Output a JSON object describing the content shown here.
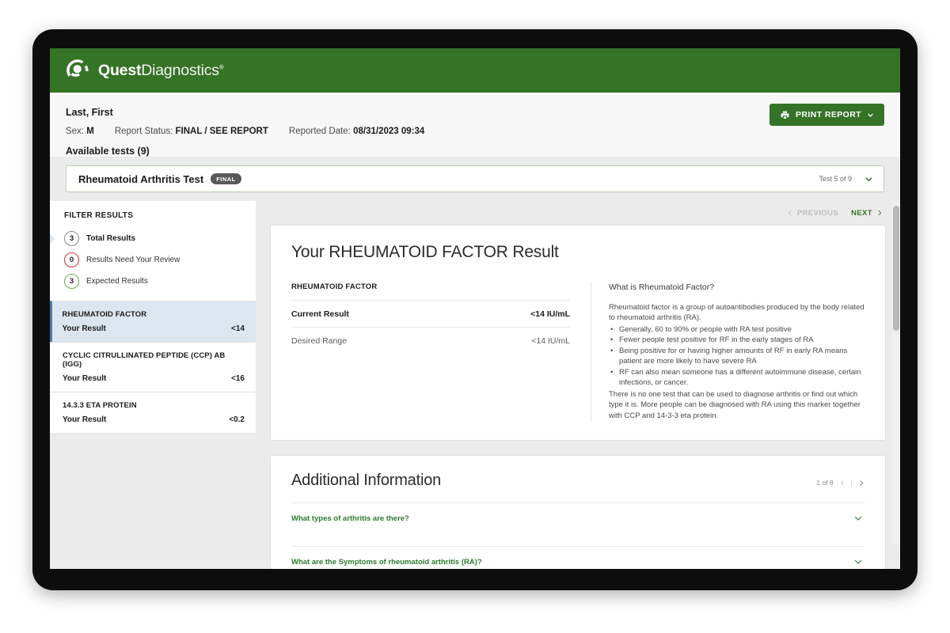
{
  "brand": {
    "name_bold": "Quest",
    "name_light": "Diagnostics",
    "registered_mark": "®",
    "logo_icon": "quest-swirl-logo",
    "header_color": "#357326"
  },
  "patient": {
    "name": "Last, First",
    "sex_label": "Sex:",
    "sex_value": "M",
    "report_status_label": "Report Status:",
    "report_status_value": "FINAL / SEE REPORT",
    "reported_date_label": "Reported Date:",
    "reported_date_value": "08/31/2023 09:34",
    "available_tests": "Available tests (9)"
  },
  "print_button": {
    "label": "PRINT REPORT",
    "icon": "printer-icon",
    "caret_icon": "chevron-down-icon"
  },
  "test_selector": {
    "title": "Rheumatoid Arthritis Test",
    "badge": "FINAL",
    "counter": "Test 5 of 9",
    "caret_icon": "chevron-down-icon"
  },
  "filter": {
    "title": "FILTER RESULTS",
    "items": [
      {
        "count": "3",
        "label": "Total Results",
        "color": "#8a8a8a",
        "active": true
      },
      {
        "count": "0",
        "label": "Results Need Your Review",
        "color": "#d0342c",
        "active": false
      },
      {
        "count": "3",
        "label": "Expected Results",
        "color": "#6aa84f",
        "active": false
      }
    ]
  },
  "test_list": [
    {
      "name": "RHEUMATOID FACTOR",
      "result_label": "Your Result",
      "result_value": "<14",
      "selected": true
    },
    {
      "name": "CYCLIC CITRULLINATED PEPTIDE (CCP) AB (IGG)",
      "result_label": "Your Result",
      "result_value": "<16",
      "selected": false
    },
    {
      "name": "14.3.3 ETA PROTEIN",
      "result_label": "Your Result",
      "result_value": "<0.2",
      "selected": false
    }
  ],
  "pager": {
    "previous": "PREVIOUS",
    "next": "NEXT",
    "prev_icon": "chevron-left-icon",
    "next_icon": "chevron-right-icon"
  },
  "result": {
    "title": "Your RHEUMATOID FACTOR Result",
    "analyte": "RHEUMATOID FACTOR",
    "rows": [
      {
        "label": "Current Result",
        "value": "<14 IU/mL"
      },
      {
        "label": "Desired Range",
        "value": "<14 IU/mL"
      }
    ],
    "info_heading": "What is Rheumatoid Factor?",
    "info_intro": "Rheumatoid factor is a group of autoantibodies produced by the body related to rheumatoid arthritis (RA).",
    "info_bullets": [
      "Generally, 60 to 90% or people with RA test positive",
      "Fewer people test positive for RF in the early stages of RA",
      "Being positive for or having higher amounts of RF in early RA means patient are more likely to have severe RA",
      "RF can also mean someone has a different autoimmune disease, certain infections, or cancer."
    ],
    "info_outro": "There is no one test that can be used to diagnose arthritis or find out which type it is. More people can be diagnosed with RA using this marker together with CCP and 14-3-3 eta protein."
  },
  "additional_information": {
    "title": "Additional Information",
    "counter": "1 of 8",
    "divider": "|",
    "prev_icon": "chevron-left-icon",
    "next_icon": "chevron-right-icon",
    "faqs": [
      {
        "question": "What types of arthritis are there?",
        "chevron": "chevron-down-icon"
      },
      {
        "question": "What are the Symptoms of rheumatoid arthritis (RA)?",
        "chevron": "chevron-down-icon"
      }
    ]
  }
}
